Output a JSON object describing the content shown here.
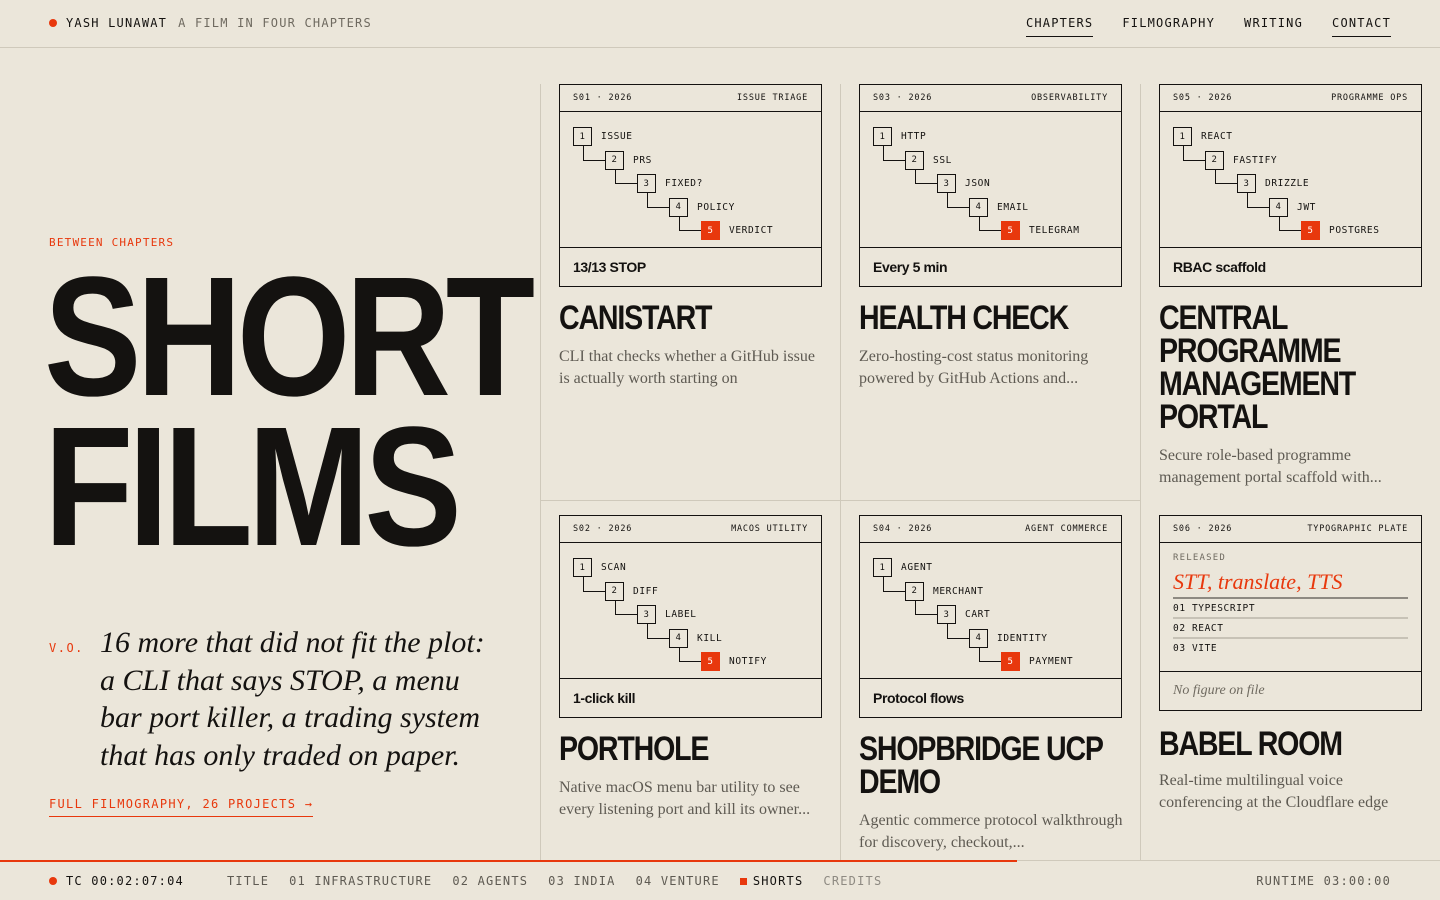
{
  "header": {
    "brand": "YASH LUNAWAT",
    "tagline": "A FILM IN FOUR CHAPTERS",
    "nav": [
      "CHAPTERS",
      "FILMOGRAPHY",
      "WRITING",
      "CONTACT"
    ]
  },
  "hero": {
    "eyebrow": "BETWEEN CHAPTERS",
    "title_line1": "SHORT",
    "title_line2": "FILMS",
    "vo_label": "V.O.",
    "quote": "16 more that did not fit the plot: a CLI that says STOP, a menu bar port killer, a trading system that has only traded on paper.",
    "link": "FULL FILMOGRAPHY, 26 PROJECTS →"
  },
  "cards": [
    {
      "season": "S01 · 2026",
      "category": "ISSUE TRIAGE",
      "steps": [
        "ISSUE",
        "PRS",
        "FIXED?",
        "POLICY",
        "VERDICT"
      ],
      "footer": "13/13 STOP",
      "title": "CANISTART",
      "desc": "CLI that checks whether a GitHub issue is actually worth starting on"
    },
    {
      "season": "S03 · 2026",
      "category": "OBSERVABILITY",
      "steps": [
        "HTTP",
        "SSL",
        "JSON",
        "EMAIL",
        "TELEGRAM"
      ],
      "footer": "Every 5 min",
      "title": "HEALTH CHECK",
      "desc": "Zero-hosting-cost status monitoring powered by GitHub Actions and..."
    },
    {
      "season": "S05 · 2026",
      "category": "PROGRAMME OPS",
      "steps": [
        "REACT",
        "FASTIFY",
        "DRIZZLE",
        "JWT",
        "POSTGRES"
      ],
      "footer": "RBAC scaffold",
      "title": "CENTRAL PROGRAMME MANAGEMENT PORTAL",
      "desc": "Secure role-based programme management portal scaffold with..."
    },
    {
      "season": "S02 · 2026",
      "category": "MACOS UTILITY",
      "steps": [
        "SCAN",
        "DIFF",
        "LABEL",
        "KILL",
        "NOTIFY"
      ],
      "footer": "1-click kill",
      "title": "PORTHOLE",
      "desc": "Native macOS menu bar utility to see every listening port and kill its owner..."
    },
    {
      "season": "S04 · 2026",
      "category": "AGENT COMMERCE",
      "steps": [
        "AGENT",
        "MERCHANT",
        "CART",
        "IDENTITY",
        "PAYMENT"
      ],
      "footer": "Protocol flows",
      "title": "SHOPBRIDGE UCP DEMO",
      "desc": "Agentic commerce protocol walkthrough for discovery, checkout,..."
    }
  ],
  "babel": {
    "season": "S06 · 2026",
    "category": "TYPOGRAPHIC PLATE",
    "released": "RELEASED",
    "headline": "STT, translate, TTS",
    "lines": [
      "01 TYPESCRIPT",
      "02 REACT",
      "03 VITE"
    ],
    "footer": "No figure on file",
    "title": "BABEL ROOM",
    "desc": "Real-time multilingual voice conferencing at the Cloudflare edge"
  },
  "footer": {
    "timecode": "TC 00:02:07:04",
    "chapters": [
      "TITLE",
      "01 INFRASTRUCTURE",
      "02 AGENTS",
      "03 INDIA",
      "04 VENTURE",
      "SHORTS",
      "CREDITS"
    ],
    "runtime": "RUNTIME 03:00:00",
    "progress": 0.706,
    "accent_color": "#e8380d"
  }
}
